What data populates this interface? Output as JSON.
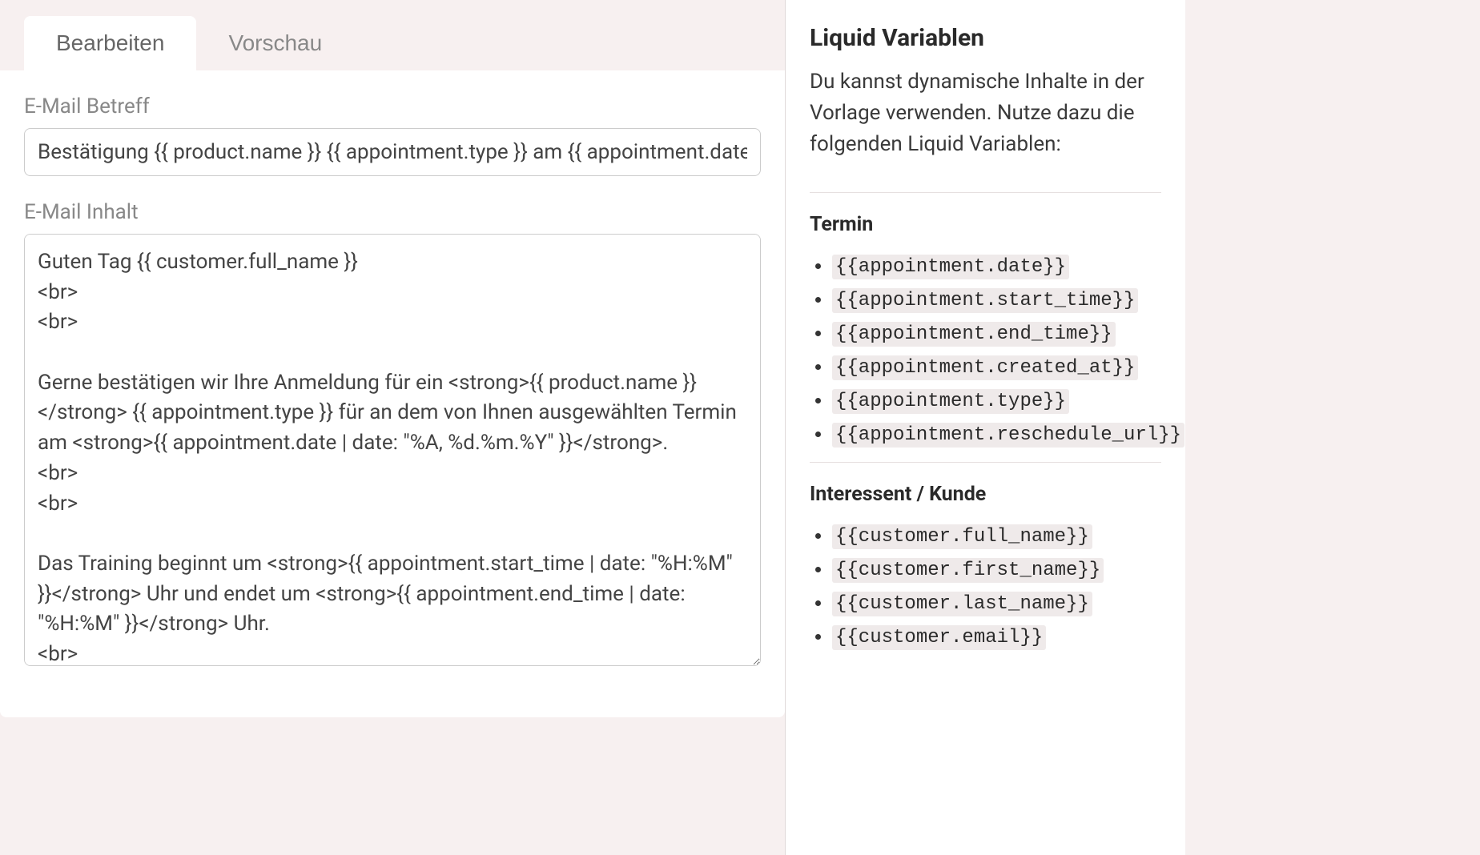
{
  "tabs": {
    "edit_label": "Bearbeiten",
    "preview_label": "Vorschau"
  },
  "form": {
    "subject_label": "E-Mail Betreff",
    "subject_value": "Bestätigung {{ product.name }} {{ appointment.type }} am {{ appointment.date | date: \"%A, %d.%m.%Y\" }}",
    "body_label": "E-Mail Inhalt",
    "body_value": "Guten Tag {{ customer.full_name }}\n<br>\n<br>\n\nGerne bestätigen wir Ihre Anmeldung für ein <strong>{{ product.name }}</strong> {{ appointment.type }} für an dem von Ihnen ausgewählten Termin am <strong>{{ appointment.date | date: \"%A, %d.%m.%Y\" }}</strong>.\n<br>\n<br>\n\nDas Training beginnt um <strong>{{ appointment.start_time | date: \"%H:%M\" }}</strong> Uhr und endet um <strong>{{ appointment.end_time | date: \"%H:%M\" }}</strong> Uhr.\n<br>"
  },
  "sidebar": {
    "title": "Liquid Variablen",
    "intro": "Du kannst dynamische Inhalte in der Vorlage verwenden. Nutze dazu die folgenden Liquid Variablen:",
    "sections": [
      {
        "heading": "Termin",
        "vars": [
          "{{appointment.date}}",
          "{{appointment.start_time}}",
          "{{appointment.end_time}}",
          "{{appointment.created_at}}",
          "{{appointment.type}}",
          "{{appointment.reschedule_url}}"
        ]
      },
      {
        "heading": "Interessent / Kunde",
        "vars": [
          "{{customer.full_name}}",
          "{{customer.first_name}}",
          "{{customer.last_name}}",
          "{{customer.email}}"
        ]
      }
    ]
  }
}
